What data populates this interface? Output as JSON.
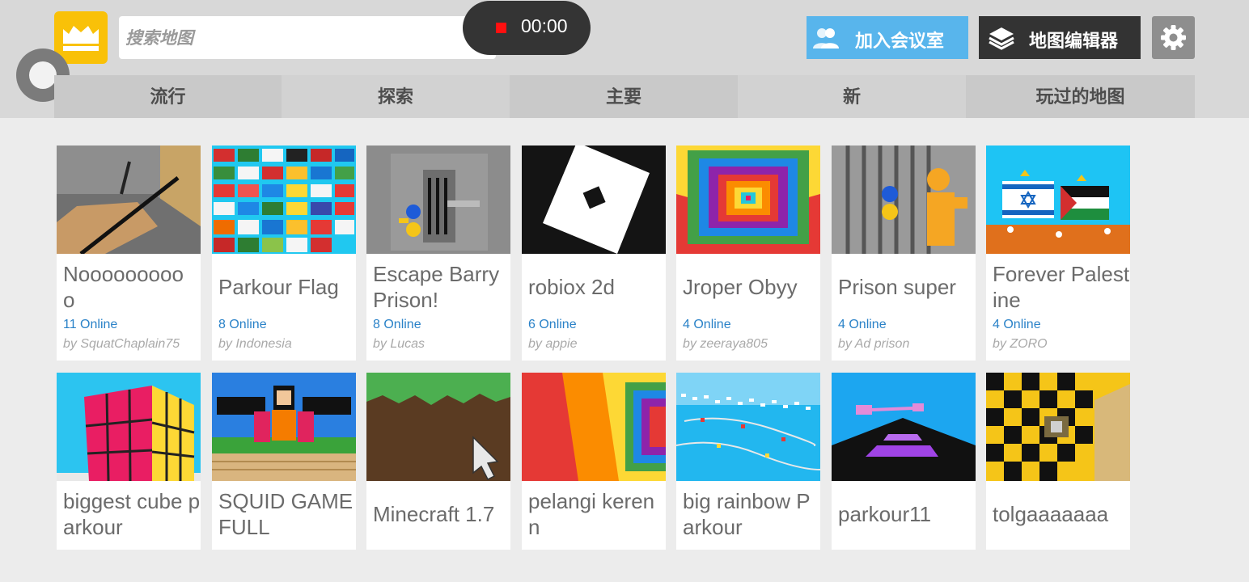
{
  "search": {
    "placeholder": "搜索地图"
  },
  "recorder": {
    "time": "00:00"
  },
  "header": {
    "join_label": "加入会议室",
    "editor_label": "地图编辑器"
  },
  "tabs": [
    {
      "label": "流行"
    },
    {
      "label": "探索"
    },
    {
      "label": "主要"
    },
    {
      "label": "新"
    },
    {
      "label": "玩过的地图"
    }
  ],
  "maps_row1": [
    {
      "title": "Nooooooooo o",
      "online": "11 Online",
      "author": "by SquatChaplain75"
    },
    {
      "title": "Parkour Flag",
      "online": "8 Online",
      "author": "by Indonesia"
    },
    {
      "title": "Escape Barry Prison!",
      "online": "8 Online",
      "author": "by Lucas"
    },
    {
      "title": "robiox 2d",
      "online": "6 Online",
      "author": "by appie"
    },
    {
      "title": "Jroper Obyy",
      "online": "4 Online",
      "author": "by zeeraya805"
    },
    {
      "title": "Prison super",
      "online": "4 Online",
      "author": "by Ad prison"
    },
    {
      "title": "Forever Palestine",
      "online": "4 Online",
      "author": "by ZORO"
    }
  ],
  "maps_row2": [
    {
      "title": "biggest cube parkour"
    },
    {
      "title": "SQUID GAME FULL"
    },
    {
      "title": "Minecraft 1.7"
    },
    {
      "title": "pelangi kerenn"
    },
    {
      "title": "big rainbow Parkour"
    },
    {
      "title": "parkour11"
    },
    {
      "title": "tolgaaaaaaa"
    }
  ],
  "icons": {
    "logo": "crown-icon",
    "search": "search-icon",
    "join": "users-icon",
    "editor": "layers-icon",
    "settings": "gear-icon",
    "record": "record-icon"
  },
  "colors": {
    "logo_bg": "#f9c108",
    "join_bg": "#58b5ec",
    "editor_bg": "#333333",
    "gear_bg": "#8e8e8e",
    "online_text": "#2a82c8",
    "record_dot": "#ff1010"
  }
}
